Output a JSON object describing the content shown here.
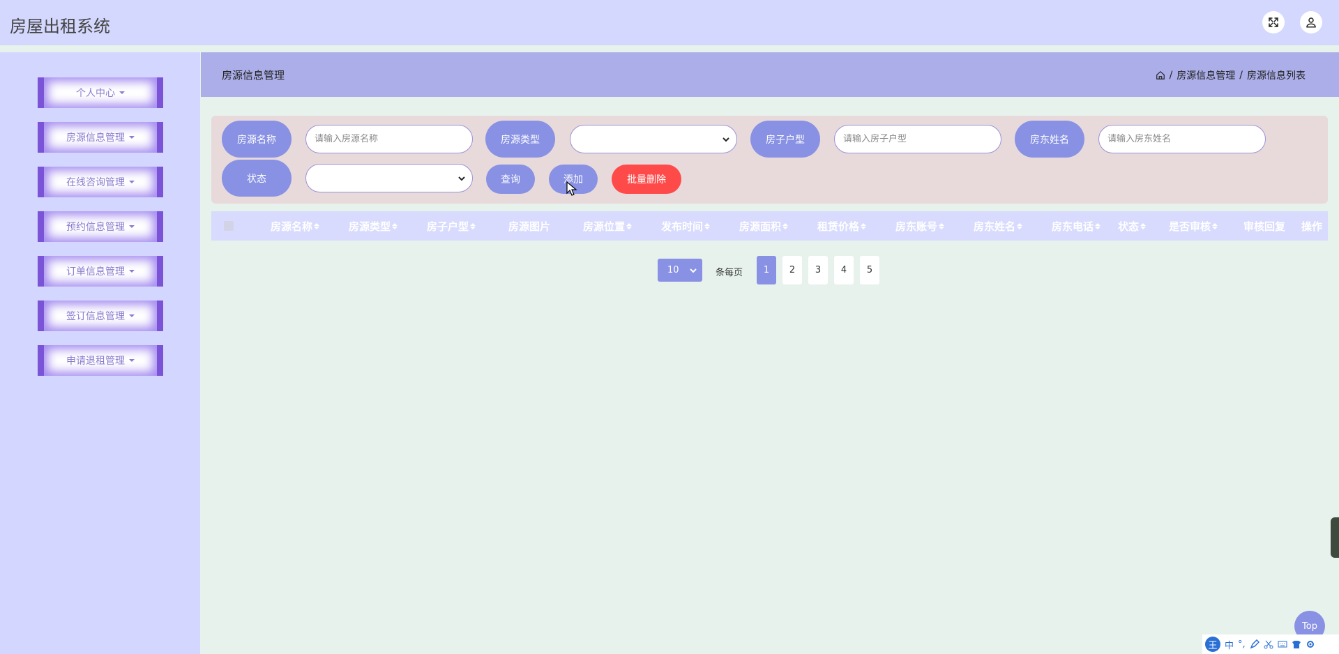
{
  "header": {
    "title": "房屋出租系统"
  },
  "sidebar": {
    "items": [
      {
        "label": "个人中心"
      },
      {
        "label": "房源信息管理"
      },
      {
        "label": "在线咨询管理"
      },
      {
        "label": "预约信息管理"
      },
      {
        "label": "订单信息管理"
      },
      {
        "label": "签订信息管理"
      },
      {
        "label": "申请退租管理"
      }
    ]
  },
  "topbar": {
    "title": "房源信息管理",
    "breadcrumb": [
      "房源信息管理",
      "房源信息列表"
    ]
  },
  "search": {
    "name_label": "房源名称",
    "name_placeholder": "请输入房源名称",
    "type_label": "房源类型",
    "layout_label": "房子户型",
    "layout_placeholder": "请输入房子户型",
    "landlord_label": "房东姓名",
    "landlord_placeholder": "请输入房东姓名",
    "status_label": "状态",
    "query_button": "查询",
    "add_button": "添加",
    "batch_delete_button": "批量删除"
  },
  "table": {
    "columns": [
      "房源名称",
      "房源类型",
      "房子户型",
      "房源图片",
      "房源位置",
      "发布时间",
      "房源面积",
      "租赁价格",
      "房东账号",
      "房东姓名",
      "房东电话",
      "状态",
      "是否审核",
      "审核回复",
      "操作"
    ]
  },
  "pagination": {
    "page_size": "10",
    "per_page_label": "条每页",
    "pages": [
      "1",
      "2",
      "3",
      "4",
      "5"
    ],
    "current": "1"
  },
  "top_button": "Top",
  "ime": {
    "logo": "王",
    "mode": "中"
  },
  "colors": {
    "accent": "#8891e3",
    "danger": "#ff4a4a",
    "menu_border": "#7b53d6"
  }
}
